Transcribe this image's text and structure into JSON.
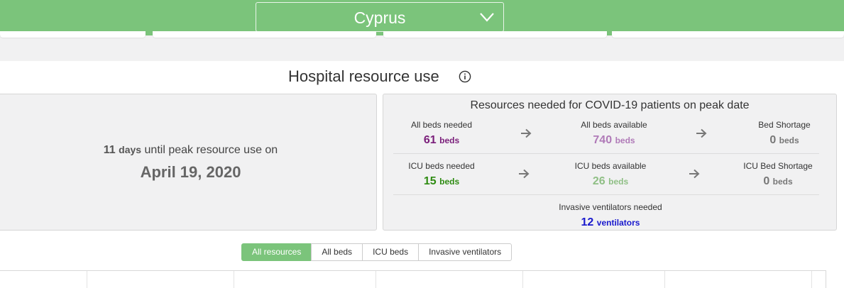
{
  "header": {
    "region": "Cyprus",
    "accent_color": "#7bc47b"
  },
  "section": {
    "title": "Hospital resource use",
    "info_icon": "info-circle-icon"
  },
  "peak": {
    "days": "11",
    "days_unit": "days",
    "text": "until peak resource use on",
    "date": "April 19, 2020"
  },
  "resources": {
    "title": "Resources needed for COVID-19 patients on peak date",
    "all_beds_needed": {
      "label": "All beds needed",
      "value": "61",
      "unit": "beds",
      "color": "#7a1e7a"
    },
    "all_beds_available": {
      "label": "All beds available",
      "value": "740",
      "unit": "beds",
      "color": "#b07ab8"
    },
    "bed_shortage": {
      "label": "Bed Shortage",
      "value": "0",
      "unit": "beds",
      "color": "#777777"
    },
    "icu_beds_needed": {
      "label": "ICU beds needed",
      "value": "15",
      "unit": "beds",
      "color": "#2e8b12"
    },
    "icu_beds_available": {
      "label": "ICU beds available",
      "value": "26",
      "unit": "beds",
      "color": "#8fbf85"
    },
    "icu_bed_shortage": {
      "label": "ICU Bed Shortage",
      "value": "0",
      "unit": "beds",
      "color": "#777777"
    },
    "ventilators_needed": {
      "label": "Invasive ventilators needed",
      "value": "12",
      "unit": "ventilators",
      "color": "#1a1acd"
    }
  },
  "filters": [
    {
      "label": "All resources",
      "active": true
    },
    {
      "label": "All beds",
      "active": false
    },
    {
      "label": "ICU beds",
      "active": false
    },
    {
      "label": "Invasive ventilators",
      "active": false
    }
  ]
}
